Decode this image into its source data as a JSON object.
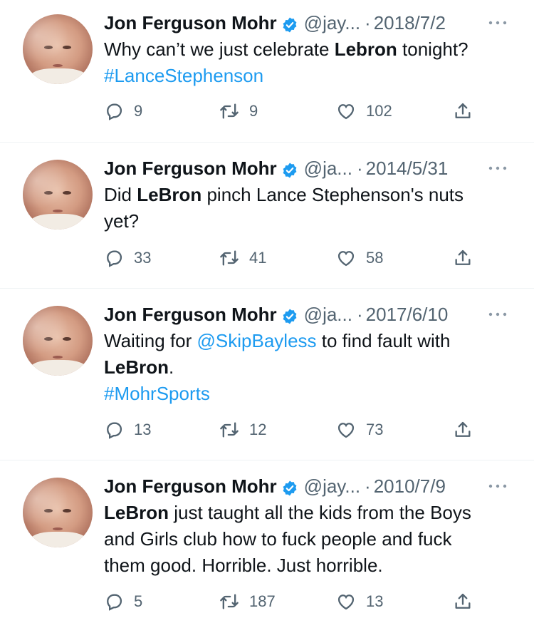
{
  "colors": {
    "link": "#1d9bf0",
    "verified": "#1d9bf0",
    "secondary_text": "#536471",
    "primary_text": "#0f1419",
    "divider": "#eff3f4"
  },
  "icons": {
    "reply": "reply-icon",
    "retweet": "retweet-icon",
    "like": "heart-icon",
    "share": "share-icon",
    "more": "more-icon",
    "verified": "verified-badge-icon"
  },
  "tweets": [
    {
      "name": "Jon Ferguson Mohr",
      "handle": "@jay...",
      "separator": "·",
      "date": "2018/7/2",
      "text_lines": [
        [
          {
            "t": "Why can’t we just celebrate ",
            "s": "plain"
          },
          {
            "t": "Lebron",
            "s": "bold"
          },
          {
            "t": " tonight?",
            "s": "plain"
          }
        ],
        [
          {
            "t": "#LanceStephenson",
            "s": "link"
          }
        ]
      ],
      "replies": "9",
      "retweets": "9",
      "likes": "102"
    },
    {
      "name": "Jon Ferguson Mohr",
      "handle": "@ja...",
      "separator": "·",
      "date": "2014/5/31",
      "text_lines": [
        [
          {
            "t": "Did ",
            "s": "plain"
          },
          {
            "t": "LeBron",
            "s": "bold"
          },
          {
            "t": " pinch Lance Stephenson's nuts",
            "s": "plain"
          }
        ],
        [
          {
            "t": "yet?",
            "s": "plain"
          }
        ]
      ],
      "replies": "33",
      "retweets": "41",
      "likes": "58"
    },
    {
      "name": "Jon Ferguson Mohr",
      "handle": "@ja...",
      "separator": "·",
      "date": "2017/6/10",
      "text_lines": [
        [
          {
            "t": "Waiting for ",
            "s": "plain"
          },
          {
            "t": "@SkipBayless",
            "s": "link"
          },
          {
            "t": " to find fault with",
            "s": "plain"
          }
        ],
        [
          {
            "t": "LeBron",
            "s": "bold"
          },
          {
            "t": ".",
            "s": "plain"
          }
        ],
        [
          {
            "t": "#MohrSports",
            "s": "link"
          }
        ]
      ],
      "replies": "13",
      "retweets": "12",
      "likes": "73"
    },
    {
      "name": "Jon Ferguson Mohr",
      "handle": "@jay...",
      "separator": "·",
      "date": "2010/7/9",
      "text_lines": [
        [
          {
            "t": "LeBron",
            "s": "bold"
          },
          {
            "t": " just taught all the kids from the Boys",
            "s": "plain"
          }
        ],
        [
          {
            "t": "and Girls club how to fuck people and fuck",
            "s": "plain"
          }
        ],
        [
          {
            "t": "them good. Horrible. Just horrible.",
            "s": "plain"
          }
        ]
      ],
      "replies": "5",
      "retweets": "187",
      "likes": "13"
    }
  ]
}
